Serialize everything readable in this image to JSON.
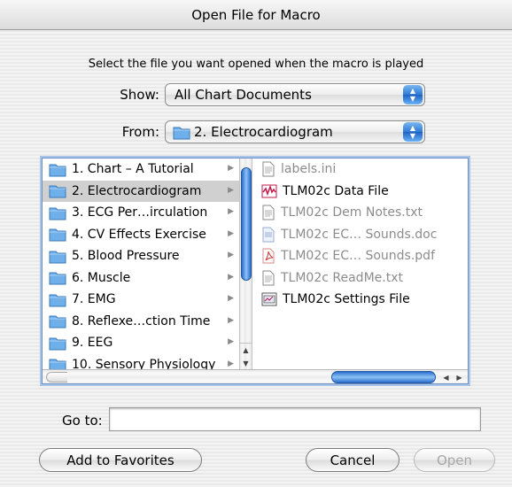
{
  "window": {
    "title": "Open File for Macro"
  },
  "prompt": "Select the file you want opened when the macro is played",
  "show": {
    "label": "Show:",
    "value": "All Chart Documents"
  },
  "from": {
    "label": "From:",
    "value": "2. Electrocardiogram"
  },
  "folders": [
    {
      "label": "1. Chart – A Tutorial"
    },
    {
      "label": "2. Electrocardiogram",
      "selected": true
    },
    {
      "label": "3. ECG Per…irculation"
    },
    {
      "label": "4. CV Effects Exercise"
    },
    {
      "label": "5. Blood Pressure"
    },
    {
      "label": "6. Muscle"
    },
    {
      "label": "7. EMG"
    },
    {
      "label": "8. Reflexe…ction Time"
    },
    {
      "label": "9. EEG"
    },
    {
      "label": "10. Sensory Physiology"
    }
  ],
  "files": [
    {
      "label": "labels.ini",
      "enabled": false,
      "icon": "text-file-icon"
    },
    {
      "label": "TLM02c Data File",
      "enabled": true,
      "icon": "chart-data-icon"
    },
    {
      "label": "TLM02c Dem Notes.txt",
      "enabled": false,
      "icon": "text-file-icon"
    },
    {
      "label": "TLM02c EC… Sounds.doc",
      "enabled": false,
      "icon": "doc-file-icon"
    },
    {
      "label": "TLM02c EC… Sounds.pdf",
      "enabled": false,
      "icon": "pdf-file-icon"
    },
    {
      "label": "TLM02c ReadMe.txt",
      "enabled": false,
      "icon": "text-file-icon"
    },
    {
      "label": "TLM02c Settings File",
      "enabled": true,
      "icon": "settings-file-icon"
    }
  ],
  "goto": {
    "label": "Go to:",
    "value": ""
  },
  "buttons": {
    "add_favorites": "Add to Favorites",
    "cancel": "Cancel",
    "open": "Open"
  }
}
